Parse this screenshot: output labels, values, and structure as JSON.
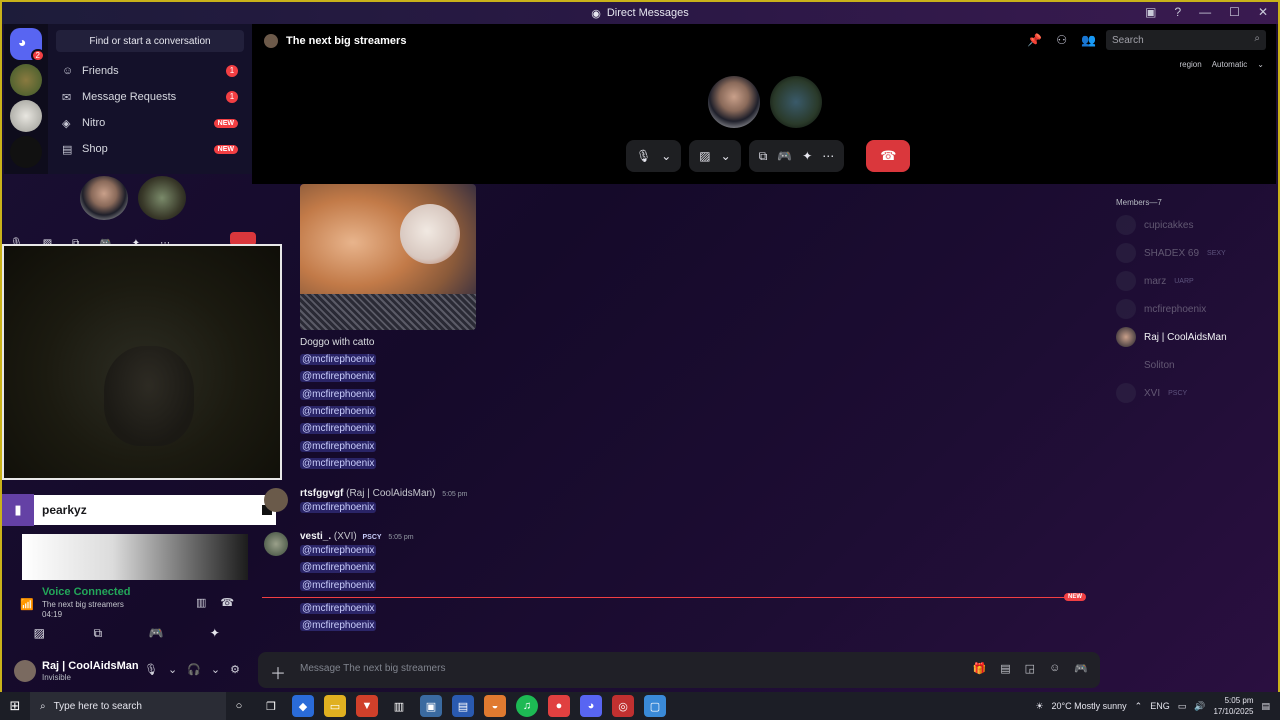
{
  "window": {
    "title": "Direct Messages"
  },
  "servers": {
    "home_badge": "2"
  },
  "sidebar": {
    "find_placeholder": "Find or start a conversation",
    "items": [
      {
        "label": "Friends",
        "count": "1",
        "icon": "friends-icon"
      },
      {
        "label": "Message Requests",
        "count": "1",
        "icon": "mail-icon"
      },
      {
        "label": "Nitro",
        "badge": "NEW",
        "icon": "nitro-icon"
      },
      {
        "label": "Shop",
        "badge": "NEW",
        "icon": "shop-icon"
      }
    ]
  },
  "header": {
    "channel": "The next big streamers",
    "search_placeholder": "Search",
    "region_label": "region",
    "region_value": "Automatic"
  },
  "messages": {
    "caption": "Doggo with catto",
    "mention": "@mcfirephoenix",
    "group1_mentions": 7,
    "msg2": {
      "author": "rtsfggvgf",
      "alias": "(Raj | CoolAidsMan)",
      "time": "5:05 pm"
    },
    "msg3": {
      "author": "vesti_.",
      "alias": "(XVI)",
      "tag": "PSCY",
      "time": "5:05 pm"
    },
    "new_label": "NEW"
  },
  "composer": {
    "placeholder": "Message The next big streamers"
  },
  "members": {
    "title": "Members—7",
    "list": [
      {
        "name": "cupicakkes",
        "tag": "",
        "dim": true
      },
      {
        "name": "SHADEX 69",
        "tag": "SEXY",
        "dim": true
      },
      {
        "name": "marz",
        "tag": "UARP",
        "dim": true
      },
      {
        "name": "mcfirephoenix",
        "tag": "",
        "dim": true
      },
      {
        "name": "Raj | CoolAidsMan",
        "tag": "",
        "dim": false
      },
      {
        "name": "Soliton",
        "tag": "",
        "dim": true
      },
      {
        "name": "XVI",
        "tag": "PSCY",
        "dim": true
      }
    ]
  },
  "overlay": {
    "twitch_name": "pearkyz"
  },
  "voice": {
    "status": "Voice Connected",
    "channel": "The next big streamers",
    "duration": "04:19"
  },
  "user": {
    "name": "Raj | CoolAidsMan",
    "status": "Invisible"
  },
  "taskbar": {
    "search_placeholder": "Type here to search",
    "weather": "20°C  Mostly sunny",
    "lang": "ENG",
    "time": "5:05 pm",
    "date": "17/10/2025"
  }
}
